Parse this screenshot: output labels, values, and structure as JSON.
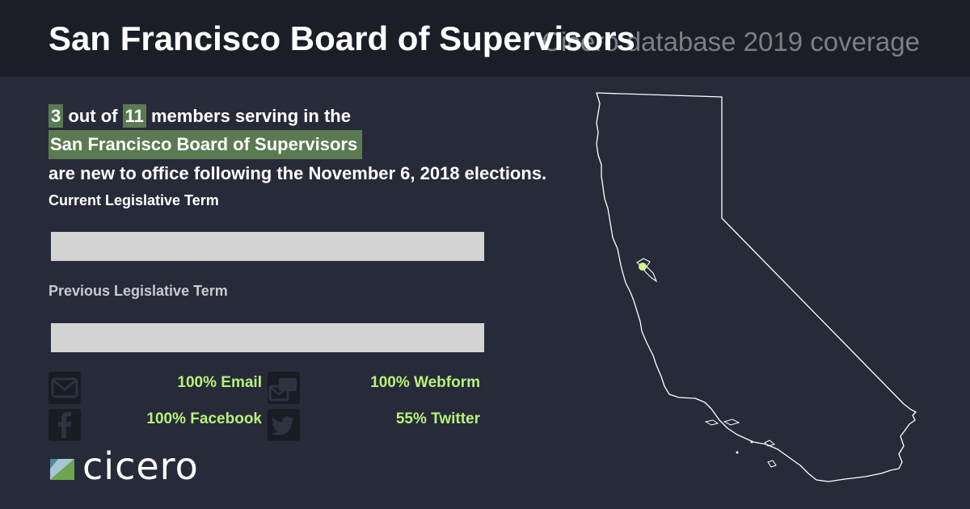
{
  "header": {
    "title": "San Francisco Board of Supervisors",
    "subtitle": "Cicero database 2019 coverage"
  },
  "summary": {
    "new_count": "3",
    "text_out_of": "out of",
    "total_count": "11",
    "text_members": "members serving in the",
    "body_name": "San Francisco Board of Supervisors",
    "text_tail": "are new to office following the November 6, 2018 elections."
  },
  "terms": {
    "current_label": "Current Legislative Term",
    "previous_label": "Previous Legislative Term"
  },
  "contact_stats": {
    "email": "100% Email",
    "webform": "100% Webform",
    "facebook": "100% Facebook",
    "twitter": "55% Twitter"
  },
  "icons": {
    "email": "envelope-icon",
    "webform": "webform-icon",
    "facebook": "facebook-icon",
    "twitter": "twitter-icon",
    "logo": "cicero-logo-mark"
  },
  "logo": {
    "text": "cicero"
  },
  "colors": {
    "background": "#272a38",
    "header_background": "#1b1e27",
    "highlight": "#5a7b52",
    "stat_green": "#b6f27a",
    "bar_grey": "#d3d3d3",
    "map_marker": "#c9f58f"
  }
}
